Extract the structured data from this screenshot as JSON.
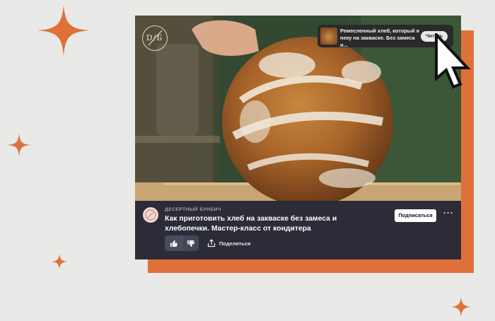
{
  "notification": {
    "text": "Ремесленный хлеб, который я пеку на закваске. Без замеса и...",
    "action_label": "Читать"
  },
  "video": {
    "channel_name": "ДЕСЕРТНЫЙ БУНБИЧ",
    "title": "Как приготовить хлеб на закваске без замеса и хлебопечки. Мастер-класс от кондитера",
    "subscribe_label": "Подписаться",
    "share_label": "Поделиться",
    "logo_text": "D/Б"
  },
  "colors": {
    "accent_orange": "#e0703a",
    "panel": "#2b2c38",
    "background": "#e9e9e7"
  },
  "icons": [
    "sparkle-icon",
    "cursor-icon",
    "thumbs-up-icon",
    "thumbs-down-icon",
    "share-icon",
    "more-icon"
  ]
}
